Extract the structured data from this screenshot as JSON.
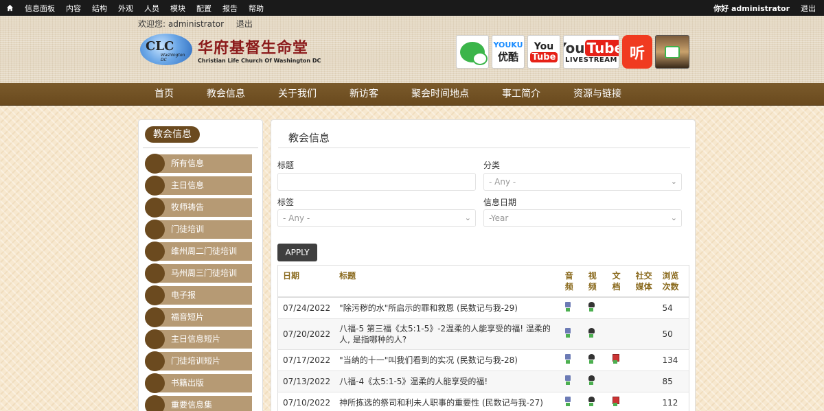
{
  "admin_bar": {
    "items": [
      "信息面板",
      "内容",
      "结构",
      "外观",
      "人员",
      "模块",
      "配置",
      "报告",
      "帮助"
    ],
    "greeting": "你好 administrator",
    "logout": "退出"
  },
  "header": {
    "welcome": "欢迎您: administrator",
    "logout": "退出",
    "logo_cn": "华府基督生命堂",
    "logo_en": "Christian Life Church Of Washington DC",
    "logo_letters": "CLC",
    "logo_small": "Washington DC",
    "social": {
      "youku_top": "YOUKU",
      "youku_cn": "优酷",
      "yt_you": "You",
      "yt_tube": "Tube",
      "ytlive_you": "You",
      "ytlive_tube": "Tube",
      "ytlive_live": "LIVESTREAM",
      "ting": "听"
    }
  },
  "nav": [
    "首页",
    "教会信息",
    "关于我们",
    "新访客",
    "聚会时间地点",
    "事工简介",
    "资源与链接"
  ],
  "sidebar": {
    "title": "教会信息",
    "items": [
      "所有信息",
      "主日信息",
      "牧师祷告",
      "门徒培训",
      "维州周二门徒培训",
      "马州周三门徒培训",
      "电子报",
      "福音短片",
      "主日信息短片",
      "门徒培训短片",
      "书籍出版",
      "重要信息集"
    ]
  },
  "main": {
    "title": "教会信息",
    "filters": {
      "title_label": "标题",
      "title_value": "",
      "category_label": "分类",
      "category_value": "- Any -",
      "tag_label": "标签",
      "tag_value": "- Any -",
      "date_label": "信息日期",
      "date_value": "-Year"
    },
    "apply": "APPLY",
    "table": {
      "headers": {
        "date": "日期",
        "title": "标题",
        "audio": "音频",
        "video": "视频",
        "doc": "文档",
        "social": "社交媒体",
        "views": "浏览次数"
      },
      "rows": [
        {
          "date": "07/24/2022",
          "title": "\"除污秽的水\"所启示的罪和救恩 (民数记与我-29)",
          "audio": true,
          "video": true,
          "doc": false,
          "social": true,
          "views": "54"
        },
        {
          "date": "07/20/2022",
          "title": "八福-5 第三福《太5:1-5》-2温柔的人能享受的福! 温柔的人, 是指哪种的人?",
          "audio": true,
          "video": true,
          "doc": false,
          "social": true,
          "views": "50"
        },
        {
          "date": "07/17/2022",
          "title": "\"当纳的十一\"叫我们看到的实况 (民数记与我-28)",
          "audio": true,
          "video": true,
          "doc": true,
          "social": true,
          "views": "134"
        },
        {
          "date": "07/13/2022",
          "title": "八福-4《太5:1-5》温柔的人能享受的福!",
          "audio": true,
          "video": true,
          "doc": false,
          "social": false,
          "views": "85"
        },
        {
          "date": "07/10/2022",
          "title": "神所拣选的祭司和利未人职事的重要性 (民数记与我-27)",
          "audio": true,
          "video": true,
          "doc": true,
          "social": true,
          "views": "112"
        }
      ]
    }
  },
  "colors": {
    "admin_bar": "#1a1a1a",
    "nav": "#6a4a1e",
    "sidebar_item": "#b69a74",
    "sidebar_dot": "#6b4a1f",
    "table_header": "#8a6a1e",
    "logo_red": "#8b1a1a"
  },
  "icons": {
    "home": "home-icon",
    "audio": "audio-icon",
    "video": "video-icon",
    "doc": "pdf-icon",
    "social": "social-icon"
  }
}
